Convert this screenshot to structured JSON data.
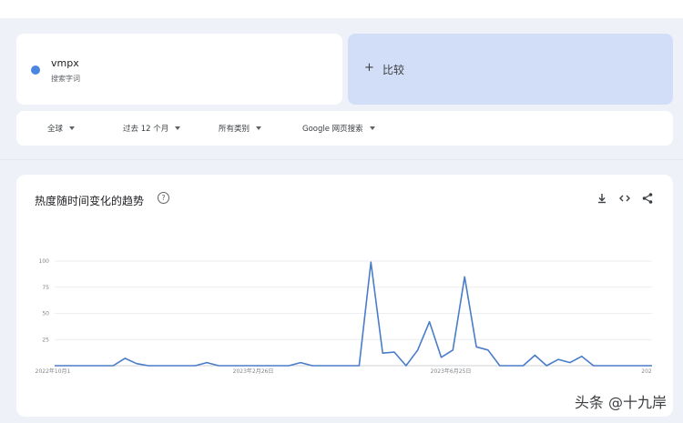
{
  "term": {
    "name": "vmpx",
    "type": "搜索字词",
    "dot_color": "#4a86e0"
  },
  "compare": {
    "plus": "+",
    "label": "比较"
  },
  "filters": [
    {
      "label": "全球"
    },
    {
      "label": "过去 12 个月"
    },
    {
      "label": "所有类别"
    },
    {
      "label": "Google 网页搜索"
    }
  ],
  "chart_panel": {
    "title": "热度随时间变化的趋势",
    "help_icon": "question-circle-icon",
    "tools": [
      "download-icon",
      "embed-code-icon",
      "share-icon"
    ]
  },
  "chart_data": {
    "type": "line",
    "title": "热度随时间变化的趋势",
    "ylim": [
      0,
      100
    ],
    "yticks": [
      25,
      50,
      75,
      100
    ],
    "xtick_labels": [
      "2022年10月1",
      "2023年2月26日",
      "2023年6月25日",
      "202"
    ],
    "grid": true,
    "series": [
      {
        "color": "#4a7cc9",
        "values": [
          0,
          0,
          0,
          0,
          0,
          0,
          7,
          2,
          0,
          0,
          0,
          0,
          0,
          3,
          0,
          0,
          0,
          0,
          0,
          0,
          0,
          3,
          0,
          0,
          0,
          0,
          0,
          99,
          12,
          13,
          0,
          15,
          42,
          8,
          15,
          85,
          18,
          15,
          0,
          0,
          0,
          10,
          0,
          6,
          3,
          9,
          0,
          0,
          0,
          0,
          0,
          0
        ]
      }
    ]
  },
  "watermark": "头条 @十九岸"
}
